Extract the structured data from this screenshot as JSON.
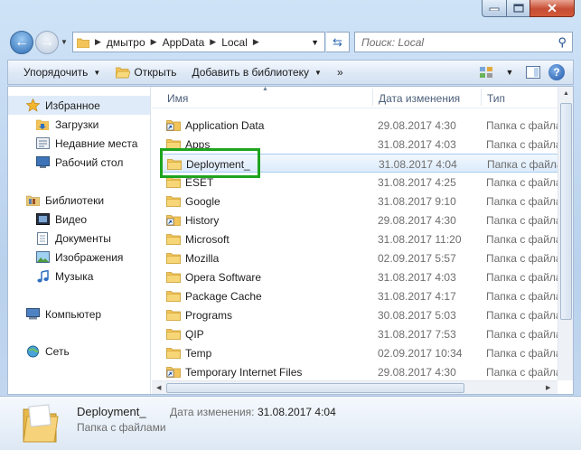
{
  "address": {
    "crumbs": [
      "дмытро",
      "AppData",
      "Local"
    ]
  },
  "search": {
    "placeholder": "Поиск: Local"
  },
  "toolbar": {
    "organize": "Упорядочить",
    "open": "Открыть",
    "add_to_library": "Добавить в библиотеку",
    "more": "»"
  },
  "nav": {
    "favorites": "Избранное",
    "downloads": "Загрузки",
    "recent": "Недавние места",
    "desktop": "Рабочий стол",
    "libraries": "Библиотеки",
    "video": "Видео",
    "documents": "Документы",
    "images": "Изображения",
    "music": "Музыка",
    "computer": "Компьютер",
    "network": "Сеть"
  },
  "columns": {
    "name": "Имя",
    "date": "Дата изменения",
    "type": "Тип"
  },
  "files": [
    {
      "name": "Application Data",
      "date": "29.08.2017 4:30",
      "type": "Папка с файлами",
      "shortcut": true
    },
    {
      "name": "Apps",
      "date": "31.08.2017 4:03",
      "type": "Папка с файлами",
      "shortcut": false
    },
    {
      "name": "Deployment_",
      "date": "31.08.2017 4:04",
      "type": "Папка с файлами",
      "shortcut": false
    },
    {
      "name": "ESET",
      "date": "31.08.2017 4:25",
      "type": "Папка с файлами",
      "shortcut": false
    },
    {
      "name": "Google",
      "date": "31.08.2017 9:10",
      "type": "Папка с файлами",
      "shortcut": false
    },
    {
      "name": "History",
      "date": "29.08.2017 4:30",
      "type": "Папка с файлами",
      "shortcut": true
    },
    {
      "name": "Microsoft",
      "date": "31.08.2017 11:20",
      "type": "Папка с файлами",
      "shortcut": false
    },
    {
      "name": "Mozilla",
      "date": "02.09.2017 5:57",
      "type": "Папка с файлами",
      "shortcut": false
    },
    {
      "name": "Opera Software",
      "date": "31.08.2017 4:03",
      "type": "Папка с файлами",
      "shortcut": false
    },
    {
      "name": "Package Cache",
      "date": "31.08.2017 4:17",
      "type": "Папка с файлами",
      "shortcut": false
    },
    {
      "name": "Programs",
      "date": "30.08.2017 5:03",
      "type": "Папка с файлами",
      "shortcut": false
    },
    {
      "name": "QIP",
      "date": "31.08.2017 7:53",
      "type": "Папка с файлами",
      "shortcut": false
    },
    {
      "name": "Temp",
      "date": "02.09.2017 10:34",
      "type": "Папка с файлами",
      "shortcut": false
    },
    {
      "name": "Temporary Internet Files",
      "date": "29.08.2017 4:30",
      "type": "Папка с файлами",
      "shortcut": true
    }
  ],
  "selected_index": 2,
  "details": {
    "name": "Deployment_",
    "type": "Папка с файлами",
    "date_label": "Дата изменения:",
    "date_value": "31.08.2017 4:04"
  },
  "colors": {
    "highlight_box": "#1ea51e",
    "folder": "#f2c45a"
  }
}
